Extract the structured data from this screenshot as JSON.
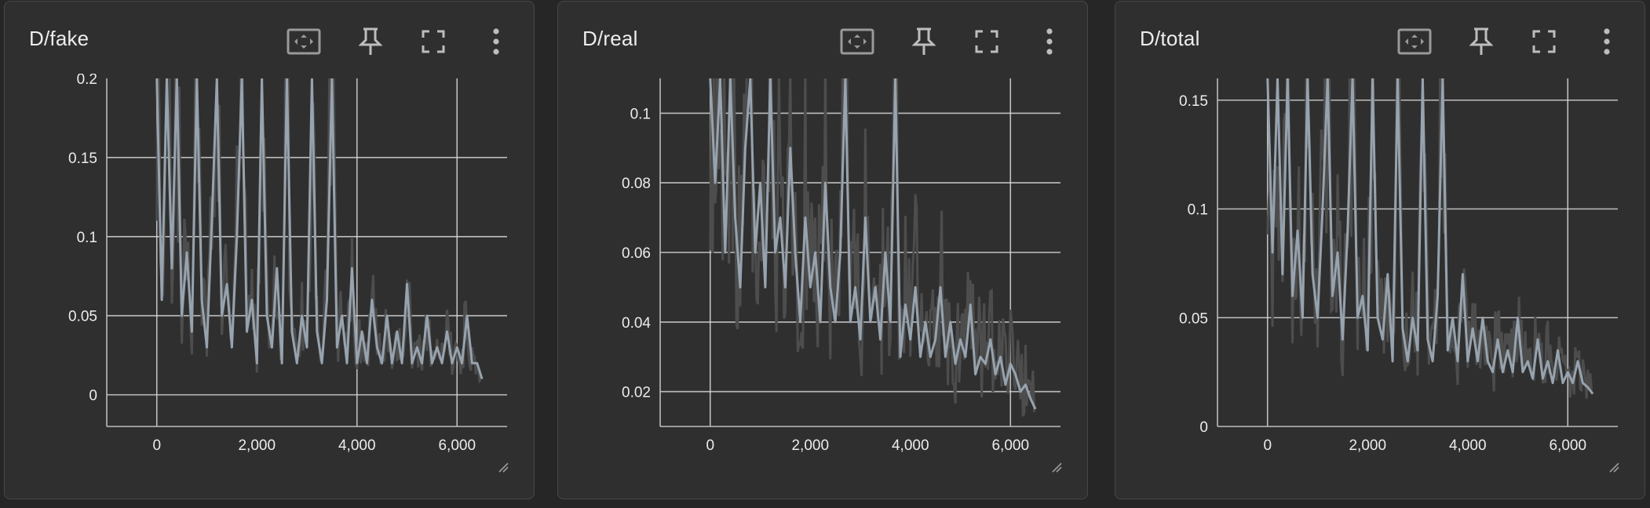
{
  "colors": {
    "page_bg": "#262626",
    "card_bg": "#2f2f2f",
    "smoothed_line": "#97a3ae",
    "raw_line": "#4d4d4d",
    "grid": "#d9d9d9",
    "axis": "#bdbdbd",
    "text": "#ececec"
  },
  "icons": {
    "fit": "fit-domain-icon",
    "pin": "pin-icon",
    "fullscreen": "fullscreen-icon",
    "menu": "more-vert-icon",
    "resize": "resize-handle-icon"
  },
  "cards": [
    {
      "title": "D/fake",
      "chart_index": 0
    },
    {
      "title": "D/real",
      "chart_index": 1
    },
    {
      "title": "D/total",
      "chart_index": 2
    }
  ],
  "chart_data": [
    {
      "type": "line",
      "title": "D/fake",
      "xlabel": "",
      "ylabel": "",
      "xlim": [
        -1000,
        7000
      ],
      "ylim": [
        -0.02,
        0.2
      ],
      "x_ticks": [
        0,
        2000,
        4000,
        6000
      ],
      "x_tick_labels": [
        "0",
        "2,000",
        "4,000",
        "6,000"
      ],
      "y_ticks": [
        0,
        0.05,
        0.1,
        0.15,
        0.2
      ],
      "y_tick_labels": [
        "0",
        "0.05",
        "0.1",
        "0.15",
        "0.2"
      ],
      "x_gridlines": [
        0,
        4000,
        6000
      ],
      "y_gridlines": [
        0,
        0.05,
        0.1,
        0.15
      ],
      "grid": true,
      "series": [
        {
          "x": [
            0,
            100,
            200,
            300,
            400,
            500,
            600,
            700,
            800,
            900,
            1000,
            1100,
            1200,
            1300,
            1400,
            1500,
            1600,
            1700,
            1800,
            1900,
            2000,
            2100,
            2200,
            2300,
            2400,
            2500,
            2600,
            2700,
            2800,
            2900,
            3000,
            3100,
            3200,
            3300,
            3400,
            3500,
            3600,
            3700,
            3800,
            3900,
            4000,
            4100,
            4200,
            4300,
            4400,
            4500,
            4600,
            4700,
            4800,
            4900,
            5000,
            5100,
            5200,
            5300,
            5400,
            5500,
            5600,
            5700,
            5800,
            5900,
            6000,
            6100,
            6200,
            6300,
            6400,
            6500
          ],
          "y": [
            0.2,
            0.06,
            0.2,
            0.08,
            0.2,
            0.05,
            0.09,
            0.04,
            0.2,
            0.06,
            0.03,
            0.11,
            0.2,
            0.05,
            0.07,
            0.03,
            0.1,
            0.2,
            0.04,
            0.06,
            0.02,
            0.2,
            0.05,
            0.03,
            0.08,
            0.02,
            0.2,
            0.04,
            0.02,
            0.05,
            0.03,
            0.2,
            0.04,
            0.02,
            0.06,
            0.2,
            0.03,
            0.05,
            0.02,
            0.08,
            0.02,
            0.04,
            0.02,
            0.06,
            0.03,
            0.02,
            0.05,
            0.02,
            0.04,
            0.02,
            0.07,
            0.02,
            0.03,
            0.02,
            0.05,
            0.02,
            0.03,
            0.02,
            0.04,
            0.02,
            0.03,
            0.02,
            0.05,
            0.02,
            0.02,
            0.01
          ]
        }
      ]
    },
    {
      "type": "line",
      "title": "D/real",
      "xlabel": "",
      "ylabel": "",
      "xlim": [
        -1000,
        7000
      ],
      "ylim": [
        0.01,
        0.11
      ],
      "x_ticks": [
        0,
        2000,
        4000,
        6000
      ],
      "x_tick_labels": [
        "0",
        "2,000",
        "4,000",
        "6,000"
      ],
      "y_ticks": [
        0.02,
        0.04,
        0.06,
        0.08,
        0.1
      ],
      "y_tick_labels": [
        "0.02",
        "0.04",
        "0.06",
        "0.08",
        "0.1"
      ],
      "x_gridlines": [
        0,
        6000
      ],
      "y_gridlines": [
        0.02,
        0.04,
        0.06,
        0.08,
        0.1
      ],
      "grid": true,
      "series": [
        {
          "x": [
            0,
            100,
            200,
            300,
            400,
            500,
            600,
            700,
            800,
            900,
            1000,
            1100,
            1200,
            1300,
            1400,
            1500,
            1600,
            1700,
            1800,
            1900,
            2000,
            2100,
            2200,
            2300,
            2400,
            2500,
            2600,
            2700,
            2800,
            2900,
            3000,
            3100,
            3200,
            3300,
            3400,
            3500,
            3600,
            3700,
            3800,
            3900,
            4000,
            4100,
            4200,
            4300,
            4400,
            4500,
            4600,
            4700,
            4800,
            4900,
            5000,
            5100,
            5200,
            5300,
            5400,
            5500,
            5600,
            5700,
            5800,
            5900,
            6000,
            6100,
            6200,
            6300,
            6400,
            6500
          ],
          "y": [
            0.11,
            0.08,
            0.11,
            0.06,
            0.11,
            0.07,
            0.05,
            0.09,
            0.11,
            0.06,
            0.08,
            0.05,
            0.11,
            0.06,
            0.07,
            0.05,
            0.09,
            0.06,
            0.04,
            0.07,
            0.05,
            0.06,
            0.04,
            0.08,
            0.05,
            0.04,
            0.06,
            0.11,
            0.04,
            0.05,
            0.035,
            0.07,
            0.04,
            0.05,
            0.035,
            0.06,
            0.04,
            0.11,
            0.03,
            0.045,
            0.035,
            0.05,
            0.03,
            0.04,
            0.03,
            0.035,
            0.05,
            0.03,
            0.04,
            0.028,
            0.035,
            0.03,
            0.045,
            0.025,
            0.03,
            0.028,
            0.035,
            0.025,
            0.03,
            0.022,
            0.028,
            0.025,
            0.02,
            0.022,
            0.018,
            0.015
          ]
        }
      ]
    },
    {
      "type": "line",
      "title": "D/total",
      "xlabel": "",
      "ylabel": "",
      "xlim": [
        -1000,
        7000
      ],
      "ylim": [
        0,
        0.16
      ],
      "x_ticks": [
        0,
        2000,
        4000,
        6000
      ],
      "x_tick_labels": [
        "0",
        "2,000",
        "4,000",
        "6,000"
      ],
      "y_ticks": [
        0,
        0.05,
        0.1,
        0.15
      ],
      "y_tick_labels": [
        "0",
        "0.05",
        "0.1",
        "0.15"
      ],
      "x_gridlines": [
        0,
        6000
      ],
      "y_gridlines": [
        0.05,
        0.1,
        0.15
      ],
      "grid": true,
      "series": [
        {
          "x": [
            0,
            100,
            200,
            300,
            400,
            500,
            600,
            700,
            800,
            900,
            1000,
            1100,
            1200,
            1300,
            1400,
            1500,
            1600,
            1700,
            1800,
            1900,
            2000,
            2100,
            2200,
            2300,
            2400,
            2500,
            2600,
            2700,
            2800,
            2900,
            3000,
            3100,
            3200,
            3300,
            3400,
            3500,
            3600,
            3700,
            3800,
            3900,
            4000,
            4100,
            4200,
            4300,
            4400,
            4500,
            4600,
            4700,
            4800,
            4900,
            5000,
            5100,
            5200,
            5300,
            5400,
            5500,
            5600,
            5700,
            5800,
            5900,
            6000,
            6100,
            6200,
            6300,
            6400,
            6500
          ],
          "y": [
            0.16,
            0.08,
            0.16,
            0.07,
            0.16,
            0.06,
            0.09,
            0.05,
            0.16,
            0.07,
            0.05,
            0.1,
            0.16,
            0.06,
            0.08,
            0.04,
            0.09,
            0.16,
            0.05,
            0.06,
            0.035,
            0.16,
            0.05,
            0.04,
            0.07,
            0.03,
            0.16,
            0.045,
            0.03,
            0.05,
            0.035,
            0.16,
            0.04,
            0.03,
            0.06,
            0.16,
            0.035,
            0.05,
            0.03,
            0.07,
            0.03,
            0.045,
            0.03,
            0.05,
            0.03,
            0.025,
            0.04,
            0.025,
            0.035,
            0.025,
            0.05,
            0.025,
            0.03,
            0.022,
            0.04,
            0.022,
            0.03,
            0.02,
            0.035,
            0.02,
            0.025,
            0.02,
            0.03,
            0.02,
            0.018,
            0.015
          ]
        }
      ]
    }
  ]
}
